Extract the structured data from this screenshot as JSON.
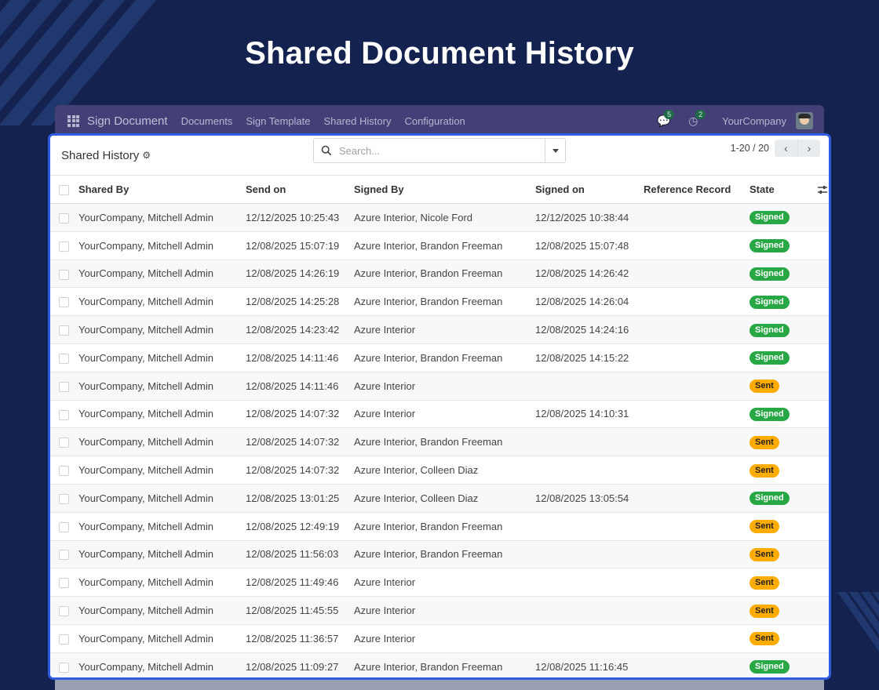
{
  "hero": {
    "title": "Shared Document History"
  },
  "topbar": {
    "app_name": "Sign Document",
    "menu": [
      "Documents",
      "Sign Template",
      "Shared History",
      "Configuration"
    ],
    "messages_count": "5",
    "activities_count": "2",
    "company": "YourCompany"
  },
  "control": {
    "breadcrumb": "Shared History",
    "search_placeholder": "Search...",
    "pager": "1-20 / 20"
  },
  "table": {
    "columns": [
      "Shared By",
      "Send on",
      "Signed By",
      "Signed on",
      "Reference Record",
      "State"
    ],
    "rows": [
      {
        "shared_by": "YourCompany, Mitchell Admin",
        "send_on": "12/12/2025 10:25:43",
        "signed_by": "Azure Interior, Nicole Ford",
        "signed_on": "12/12/2025 10:38:44",
        "reference": "",
        "state": "Signed"
      },
      {
        "shared_by": "YourCompany, Mitchell Admin",
        "send_on": "12/08/2025 15:07:19",
        "signed_by": "Azure Interior, Brandon Freeman",
        "signed_on": "12/08/2025 15:07:48",
        "reference": "",
        "state": "Signed"
      },
      {
        "shared_by": "YourCompany, Mitchell Admin",
        "send_on": "12/08/2025 14:26:19",
        "signed_by": "Azure Interior, Brandon Freeman",
        "signed_on": "12/08/2025 14:26:42",
        "reference": "",
        "state": "Signed"
      },
      {
        "shared_by": "YourCompany, Mitchell Admin",
        "send_on": "12/08/2025 14:25:28",
        "signed_by": "Azure Interior, Brandon Freeman",
        "signed_on": "12/08/2025 14:26:04",
        "reference": "",
        "state": "Signed"
      },
      {
        "shared_by": "YourCompany, Mitchell Admin",
        "send_on": "12/08/2025 14:23:42",
        "signed_by": "Azure Interior",
        "signed_on": "12/08/2025 14:24:16",
        "reference": "",
        "state": "Signed"
      },
      {
        "shared_by": "YourCompany, Mitchell Admin",
        "send_on": "12/08/2025 14:11:46",
        "signed_by": "Azure Interior, Brandon Freeman",
        "signed_on": "12/08/2025 14:15:22",
        "reference": "",
        "state": "Signed"
      },
      {
        "shared_by": "YourCompany, Mitchell Admin",
        "send_on": "12/08/2025 14:11:46",
        "signed_by": "Azure Interior",
        "signed_on": "",
        "reference": "",
        "state": "Sent"
      },
      {
        "shared_by": "YourCompany, Mitchell Admin",
        "send_on": "12/08/2025 14:07:32",
        "signed_by": "Azure Interior",
        "signed_on": "12/08/2025 14:10:31",
        "reference": "",
        "state": "Signed"
      },
      {
        "shared_by": "YourCompany, Mitchell Admin",
        "send_on": "12/08/2025 14:07:32",
        "signed_by": "Azure Interior, Brandon Freeman",
        "signed_on": "",
        "reference": "",
        "state": "Sent"
      },
      {
        "shared_by": "YourCompany, Mitchell Admin",
        "send_on": "12/08/2025 14:07:32",
        "signed_by": "Azure Interior, Colleen Diaz",
        "signed_on": "",
        "reference": "",
        "state": "Sent"
      },
      {
        "shared_by": "YourCompany, Mitchell Admin",
        "send_on": "12/08/2025 13:01:25",
        "signed_by": "Azure Interior, Colleen Diaz",
        "signed_on": "12/08/2025 13:05:54",
        "reference": "",
        "state": "Signed"
      },
      {
        "shared_by": "YourCompany, Mitchell Admin",
        "send_on": "12/08/2025 12:49:19",
        "signed_by": "Azure Interior, Brandon Freeman",
        "signed_on": "",
        "reference": "",
        "state": "Sent"
      },
      {
        "shared_by": "YourCompany, Mitchell Admin",
        "send_on": "12/08/2025 11:56:03",
        "signed_by": "Azure Interior, Brandon Freeman",
        "signed_on": "",
        "reference": "",
        "state": "Sent"
      },
      {
        "shared_by": "YourCompany, Mitchell Admin",
        "send_on": "12/08/2025 11:49:46",
        "signed_by": "Azure Interior",
        "signed_on": "",
        "reference": "",
        "state": "Sent"
      },
      {
        "shared_by": "YourCompany, Mitchell Admin",
        "send_on": "12/08/2025 11:45:55",
        "signed_by": "Azure Interior",
        "signed_on": "",
        "reference": "",
        "state": "Sent"
      },
      {
        "shared_by": "YourCompany, Mitchell Admin",
        "send_on": "12/08/2025 11:36:57",
        "signed_by": "Azure Interior",
        "signed_on": "",
        "reference": "",
        "state": "Sent"
      },
      {
        "shared_by": "YourCompany, Mitchell Admin",
        "send_on": "12/08/2025 11:09:27",
        "signed_by": "Azure Interior, Brandon Freeman",
        "signed_on": "12/08/2025 11:16:45",
        "reference": "",
        "state": "Signed"
      }
    ]
  },
  "colors": {
    "page_bg": "#13224f",
    "topbar_bg": "#434077",
    "panel_border": "#2f5be0",
    "signed_badge": "#28a745",
    "sent_badge": "#ffac00"
  },
  "icons": [
    "apps-grid-icon",
    "chat-icon",
    "clock-activity-icon",
    "gear-icon",
    "search-icon",
    "caret-down-icon",
    "chevron-left-icon",
    "chevron-right-icon",
    "optional-columns-icon"
  ]
}
